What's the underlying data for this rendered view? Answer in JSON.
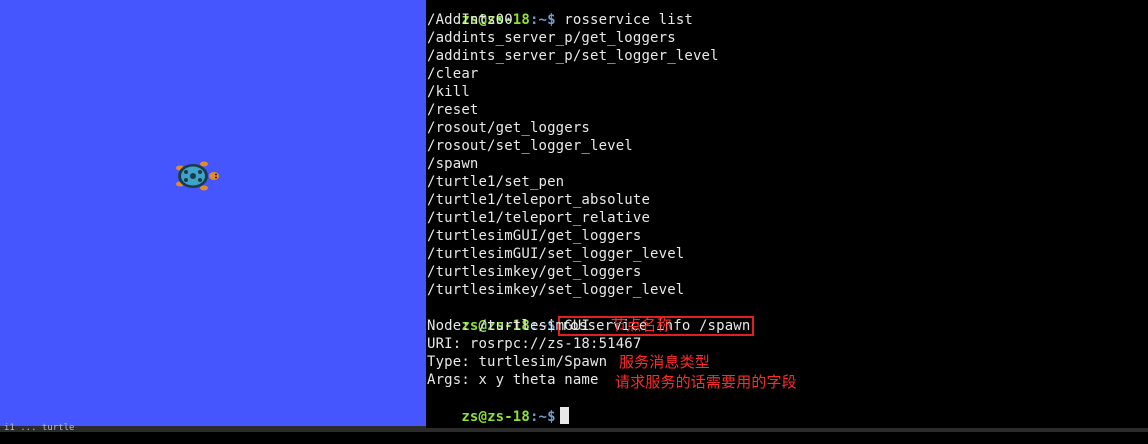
{
  "turtlesim": {
    "bottom_text": "i1 ... turtle"
  },
  "terminal": {
    "top_prompt_user": "zs@zs-18",
    "top_prompt_path": ":~$ ",
    "top_command": "rosservice list",
    "services": [
      "/AddInts00",
      "/addints_server_p/get_loggers",
      "/addints_server_p/set_logger_level",
      "/clear",
      "/kill",
      "/reset",
      "/rosout/get_loggers",
      "/rosout/set_logger_level",
      "/spawn",
      "/turtle1/set_pen",
      "/turtle1/teleport_absolute",
      "/turtle1/teleport_relative",
      "/turtlesimGUI/get_loggers",
      "/turtlesimGUI/set_logger_level",
      "/turtlesimkey/get_loggers",
      "/turtlesimkey/set_logger_level"
    ],
    "info_prompt_user": "zs@zs-18",
    "info_prompt_path": ":~$",
    "info_command": "rosservice info /spawn",
    "node_line": "Node: /turtlesimGUI",
    "uri_line": "URI: rosrpc://zs-18:51467",
    "type_line": "Type: turtlesim/Spawn",
    "args_line": "Args: x y theta name",
    "final_prompt_user": "zs@zs-18",
    "final_prompt_path": ":~$"
  },
  "annotations": {
    "node_note": "节点名称",
    "type_note": "服务消息类型",
    "args_note": "请求服务的话需要用的字段"
  },
  "colors": {
    "turtlesim_bg": "#4556ff",
    "terminal_bg": "#000000",
    "prompt_user": "#8ae234",
    "prompt_path": "#729fcf",
    "annotation_red": "#ff2a2a"
  }
}
